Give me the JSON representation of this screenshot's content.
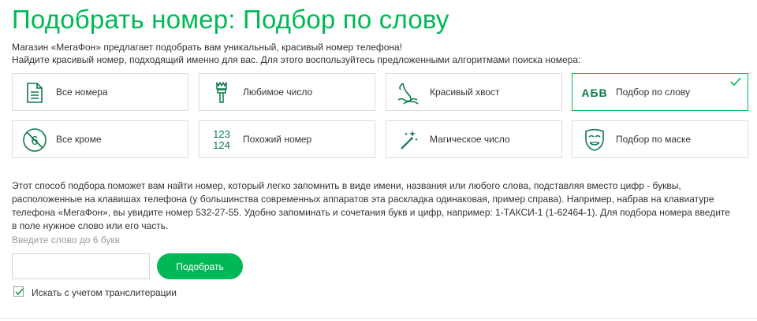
{
  "page": {
    "title": "Подобрать номер: Подбор по слову",
    "intro_line1": "Магазин «МегаФон» предлагает подобрать вам уникальный, красивый номер телефона!",
    "intro_line2": "Найдите красивый номер, подходящий именно для вас. Для этого воспользуйтесь предложенными алгоритмами поиска номера:"
  },
  "methods": [
    {
      "label": "Все номера",
      "icon": "document-icon"
    },
    {
      "label": "Любимое число",
      "icon": "brush-icon"
    },
    {
      "label": "Красивый хвост",
      "icon": "mermaid-tail-icon"
    },
    {
      "label": "Подбор по слову",
      "icon": "abv-letters-icon",
      "active": true,
      "icon_text": "АБВ"
    },
    {
      "label": "Все кроме",
      "icon": "no-six-icon"
    },
    {
      "label": "Похожий номер",
      "icon": "digits-icon",
      "icon_text_top": "123",
      "icon_text_bottom": "124"
    },
    {
      "label": "Магическое число",
      "icon": "magic-wand-icon"
    },
    {
      "label": "Подбор по маске",
      "icon": "mask-icon"
    }
  ],
  "description": "Этот способ подбора поможет вам найти номер, который легко запомнить в виде имени, названия или любого слова, подставляя вместо цифр - буквы, расположенные на клавишах телефона (у большинства современных аппаратов эта раскладка одинаковая, пример справа). Например, набрав на клавиатуре телефона «МегаФон», вы увидите номер 532-27-55. Удобно запоминать и сочетания букв и цифр, например: 1-ТАКСИ-1 (1-62464-1). Для подбора номера введите в поле нужное слово или его часть.",
  "form": {
    "hint": "Введите слово до 6 букв",
    "input_value": "",
    "submit_label": "Подобрать",
    "transliteration_label": "Искать с учетом транслитерации",
    "transliteration_checked": true
  },
  "colors": {
    "accent": "#00b956",
    "icon": "#0a7a49",
    "border": "#dcdcdc"
  }
}
